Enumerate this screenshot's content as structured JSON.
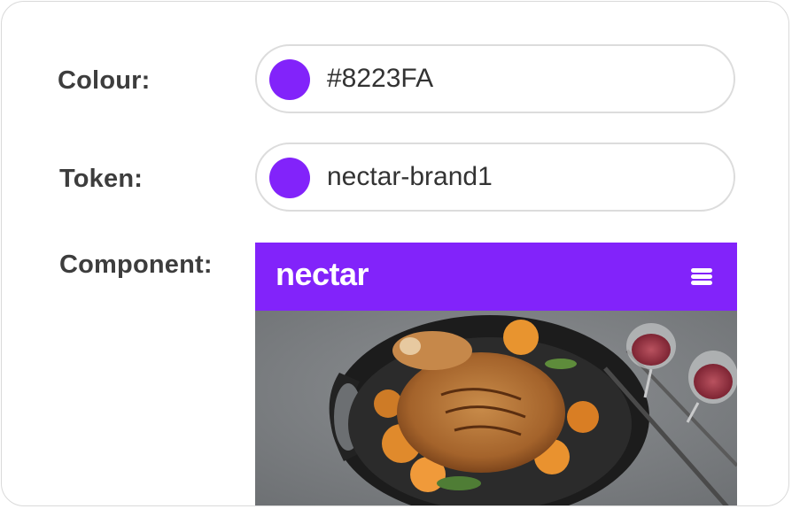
{
  "colour": {
    "label": "Colour:",
    "value": "#8223FA",
    "swatch_color": "#8223FA"
  },
  "token": {
    "label": "Token:",
    "value": "nectar-brand1",
    "swatch_color": "#8223FA"
  },
  "component": {
    "label": "Component:",
    "header_color": "#8223FA",
    "logo_text": "nectar",
    "menu_icon": "menu-icon",
    "image": "roast-chicken-photo"
  }
}
